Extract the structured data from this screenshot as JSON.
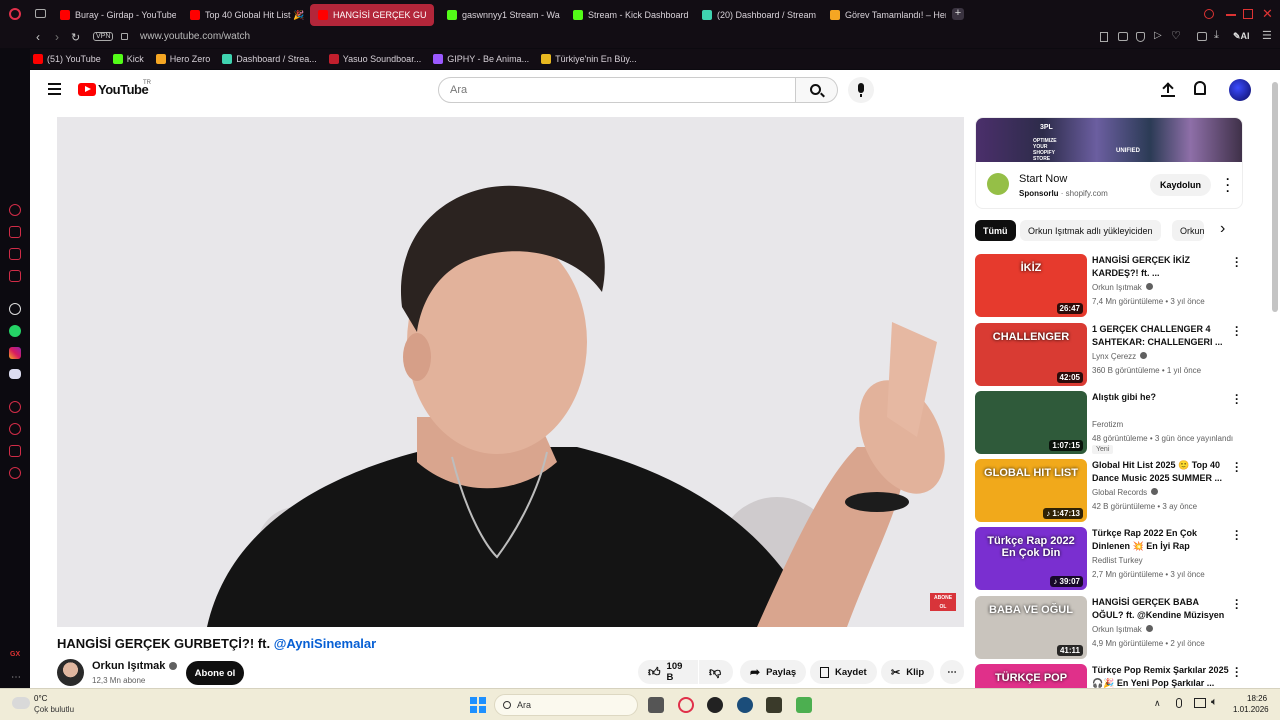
{
  "browser": {
    "tabs": [
      {
        "label": "Buray - Girdap - YouTube",
        "color": "#ff0000",
        "active": false
      },
      {
        "label": "Top 40 Global Hit List 🎉",
        "color": "#ff0000",
        "active": false
      },
      {
        "label": "HANGİSİ GERÇEK GU",
        "color": "#ff0000",
        "active": true
      },
      {
        "label": "gaswnnyy1 Stream - Watc",
        "color": "#53fc18",
        "active": false
      },
      {
        "label": "Stream - Kick Dashboard",
        "color": "#53fc18",
        "active": false
      },
      {
        "label": "(20) Dashboard / Stream",
        "color": "#3fd3b0",
        "active": false
      },
      {
        "label": "Görev Tamamlandı! – Hero",
        "color": "#f5a623",
        "active": false
      }
    ],
    "vpn_label": "VPN",
    "url": "www.youtube.com/watch",
    "ai_label": "AI",
    "bookmarks": [
      {
        "label": "(51) YouTube",
        "color": "#ff0000"
      },
      {
        "label": "Kick",
        "color": "#53fc18"
      },
      {
        "label": "Hero Zero",
        "color": "#f5a623"
      },
      {
        "label": "Dashboard / Strea...",
        "color": "#3fd3b0"
      },
      {
        "label": "Yasuo Soundboar...",
        "color": "#c21f2d"
      },
      {
        "label": "GIPHY - Be Anima...",
        "color": "#9b59ff"
      },
      {
        "label": "Türkiye'nin En Büy...",
        "color": "#e8b820"
      }
    ],
    "gx_label": "GX"
  },
  "youtube": {
    "logo_text": "YouTube",
    "region": "TR",
    "search_placeholder": "Ara",
    "video": {
      "title": "HANGİSİ GERÇEK GURBETÇİ?! ft.",
      "mention": "@AyniSinemalar",
      "watermark": "ABONE OL",
      "channel": "Orkun Işıtmak",
      "subscribers": "12,3 Mn abone",
      "subscribe_label": "Abone ol",
      "likes": "109 B",
      "share_label": "Paylaş",
      "save_label": "Kaydet",
      "clip_label": "Klip"
    },
    "ad": {
      "banner_text_1": "3PL",
      "banner_text_2": "OPTIMIZE YOUR SHOPIFY STORE",
      "banner_text_3": "UNIFIED",
      "title": "Start Now",
      "sponsored": "Sponsorlu",
      "domain": "shopify.com",
      "cta": "Kaydolun"
    },
    "chips": [
      "Tümü",
      "Orkun Işıtmak adlı yükleyiciden",
      "Orkun"
    ],
    "recommendations": [
      {
        "title": "HANGİSİ GERÇEK İKİZ KARDEŞ?! ft. ...",
        "channel": "Orkun Işıtmak",
        "verified": true,
        "meta": "7,4 Mn görüntüleme • 3 yıl önce",
        "duration": "26:47",
        "thumb_text": "İKİZ",
        "thumb_bg": "#e63a2d"
      },
      {
        "title": "1 GERÇEK CHALLENGER 4 SAHTEKAR: CHALLENGERI ...",
        "channel": "Lynx Çerezz",
        "verified": true,
        "meta": "360 B görüntüleme • 1 yıl önce",
        "duration": "42:05",
        "thumb_text": "CHALLENGER",
        "thumb_bg": "#d93b33"
      },
      {
        "title": "Alıştık gibi he?",
        "channel": "Ferotizm",
        "verified": false,
        "meta": "48 görüntüleme • 3 gün önce yayınlandı",
        "badge": "Yeni",
        "duration": "1:07:15",
        "thumb_text": "",
        "thumb_bg": "#2f5a3a"
      },
      {
        "title": "Global Hit List 2025 🙂 Top 40 Dance Music 2025 SUMMER ...",
        "channel": "Global Records",
        "verified": true,
        "meta": "42 B görüntüleme • 3 ay önce",
        "duration": "♪ 1:47:13",
        "thumb_text": "GLOBAL HIT LIST",
        "thumb_bg": "#f1a91b"
      },
      {
        "title": "Türkçe Rap 2022 En Çok Dinlenen 💥 En İyi Rap Şarkılar...",
        "channel": "Redlist Turkey",
        "verified": false,
        "meta": "2,7 Mn görüntüleme • 3 yıl önce",
        "duration": "♪ 39:07",
        "thumb_text": "Türkçe Rap 2022 En Çok Din",
        "thumb_bg": "#7a2fd0"
      },
      {
        "title": "HANGİSİ GERÇEK BABA OĞUL? ft. @Kendine Müzisyen ...",
        "channel": "Orkun Işıtmak",
        "verified": true,
        "meta": "4,9 Mn görüntüleme • 2 yıl önce",
        "duration": "41:11",
        "thumb_text": "BABA VE OĞUL",
        "thumb_bg": "#c9c4bd"
      },
      {
        "title": "Türkçe Pop Remix Şarkılar 2025 🎧🎉 En Yeni Pop Şarkılar ...",
        "channel": "",
        "verified": false,
        "meta": "",
        "duration": "",
        "thumb_text": "TÜRKÇE POP",
        "thumb_bg": "#e0308a"
      }
    ]
  },
  "taskbar": {
    "weather_temp": "0°C",
    "weather_desc": "Çok bulutlu",
    "search_placeholder": "Ara",
    "time": "18:26",
    "date": "1.01.2026"
  }
}
